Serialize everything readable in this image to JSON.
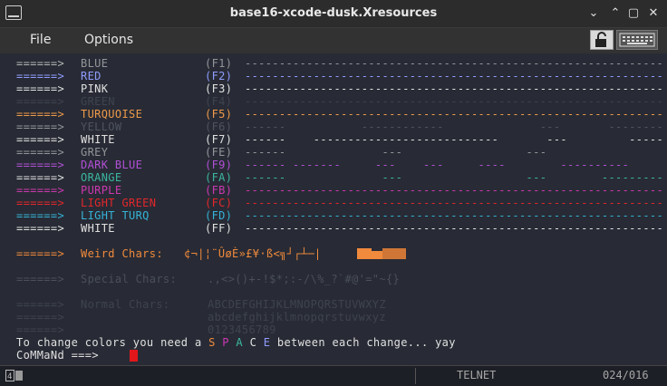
{
  "window": {
    "title": "base16-xcode-dusk.Xresources"
  },
  "menubar": {
    "items": [
      "File",
      "Options"
    ]
  },
  "icons": {
    "app": "terminal-app-icon",
    "minimize": "chevron-down-icon",
    "maximize": "chevron-up-icon",
    "restore": "square-icon",
    "close": "close-icon",
    "lock": "lock-icon",
    "keyboard": "keyboard-icon"
  },
  "terminal": {
    "colors": {
      "default": "#939599",
      "arrow": "#b4b4b4",
      "blue": "#8f9cff",
      "pink": "#e8e8e8",
      "turq": "#ef9a4a",
      "dim": "#3e4350",
      "purple": "#b14fd6",
      "pink2": "#cc38b0",
      "teal": "#3bb6a0",
      "red": "#e3262b",
      "cyan": "#35b3d6",
      "white": "#e0e0e0",
      "orange": "#f08a3c"
    },
    "rows": [
      {
        "arrow": "======>",
        "name": "BLUE",
        "code": "(F1)",
        "dash": "------------------------------------------------------------------",
        "color": "#939599",
        "arrowColor": "#b4b4b4"
      },
      {
        "arrow": "======>",
        "name": "RED",
        "code": "(F2)",
        "dash": "------------------------------------------------------------------",
        "color": "#8f9cff",
        "arrowColor": "#8f9cff"
      },
      {
        "arrow": "======>",
        "name": "PINK",
        "code": "(F3)",
        "dash": "------------------------------------------------------------------",
        "color": "#e0e0e0",
        "arrowColor": "#e0e0e0"
      },
      {
        "arrow": "======>",
        "name": "GREEN",
        "code": "(F4)",
        "dash": "------------------------------------------------------------------",
        "color": "#3e4350",
        "arrowColor": "#3e4350"
      },
      {
        "arrow": "======>",
        "name": "TURQUOISE",
        "code": "(F5)",
        "dash": "------------------------------------------------------------------",
        "color": "#ef9a4a",
        "arrowColor": "#ef9a4a"
      },
      {
        "arrow": "======>",
        "name": "YELLOW",
        "code": "(F6)",
        "dash": "------           ------------              ---       ------------",
        "color": "#4f5360",
        "arrowColor": "#939599"
      },
      {
        "arrow": "======>",
        "name": "WHITE",
        "code": "(F7)",
        "dash": "------    ---------------------------       ---         ----------",
        "color": "#e0e0e0",
        "arrowColor": "#e0e0e0"
      },
      {
        "arrow": "======>",
        "name": "GREY",
        "code": "(FE)",
        "dash": "------              ---                  ---                   ---",
        "color": "#939599",
        "arrowColor": "#939599"
      },
      {
        "arrow": "======>",
        "name": "DARK BLUE",
        "code": "(F9)",
        "dash": "------ -------     ---    ---     ----        ----------",
        "color": "#b14fd6",
        "arrowColor": "#b14fd6"
      },
      {
        "arrow": "======>",
        "name": "ORANGE",
        "code": "(FA)",
        "dash": "------              ---                  ---        ------------",
        "color": "#3bb6a0",
        "arrowColor": "#e0e0e0"
      },
      {
        "arrow": "======>",
        "name": "PURPLE",
        "code": "(FB)",
        "dash": "------------------------------------------------------------------",
        "color": "#cc38b0",
        "arrowColor": "#cc38b0"
      },
      {
        "arrow": "======>",
        "name": "LIGHT GREEN",
        "code": "(FC)",
        "dash": "------------------------------------------------------------------",
        "color": "#e3262b",
        "arrowColor": "#e3262b"
      },
      {
        "arrow": "======>",
        "name": "LIGHT TURQ",
        "code": "(FD)",
        "dash": "------------------------------------------------------------------",
        "color": "#35b3d6",
        "arrowColor": "#35b3d6"
      },
      {
        "arrow": "======>",
        "name": "WHITE",
        "code": "(FF)",
        "dash": "------------------------------------------------------------------",
        "color": "#e0e0e0",
        "arrowColor": "#e0e0e0"
      }
    ],
    "weird": {
      "arrow": "======>",
      "label": "Weird Chars:",
      "chars": "¢¬|¦¨ÛøÈ»£¥·ß<╗┘┌┴─|",
      "color": "#f08a3c"
    },
    "special": {
      "arrow": "======>",
      "label": "Special Chars:",
      "chars": ".,<>()+-!$*;:-/\\%_?`#@'=\"~{}",
      "color": "#4a4f5c"
    },
    "normal": {
      "arrow": "======>",
      "label": "Normal Chars:",
      "upper": "ABCDEFGHIJKLMNOPQRSTUVWXYZ",
      "lower": "abcdefghijklmnopqrstuvwxyz",
      "digits": "0123456789",
      "color": "#3e4350"
    },
    "hint": {
      "text": "To change colors you need a ",
      "s": "S",
      "p": "P",
      "a": "A",
      "c": "C",
      "e": "E",
      "tail": " between each change... yay"
    },
    "prompt": "CoMMaNd ===>"
  },
  "statusbar": {
    "mode": "TELNET",
    "position": "024/016"
  }
}
